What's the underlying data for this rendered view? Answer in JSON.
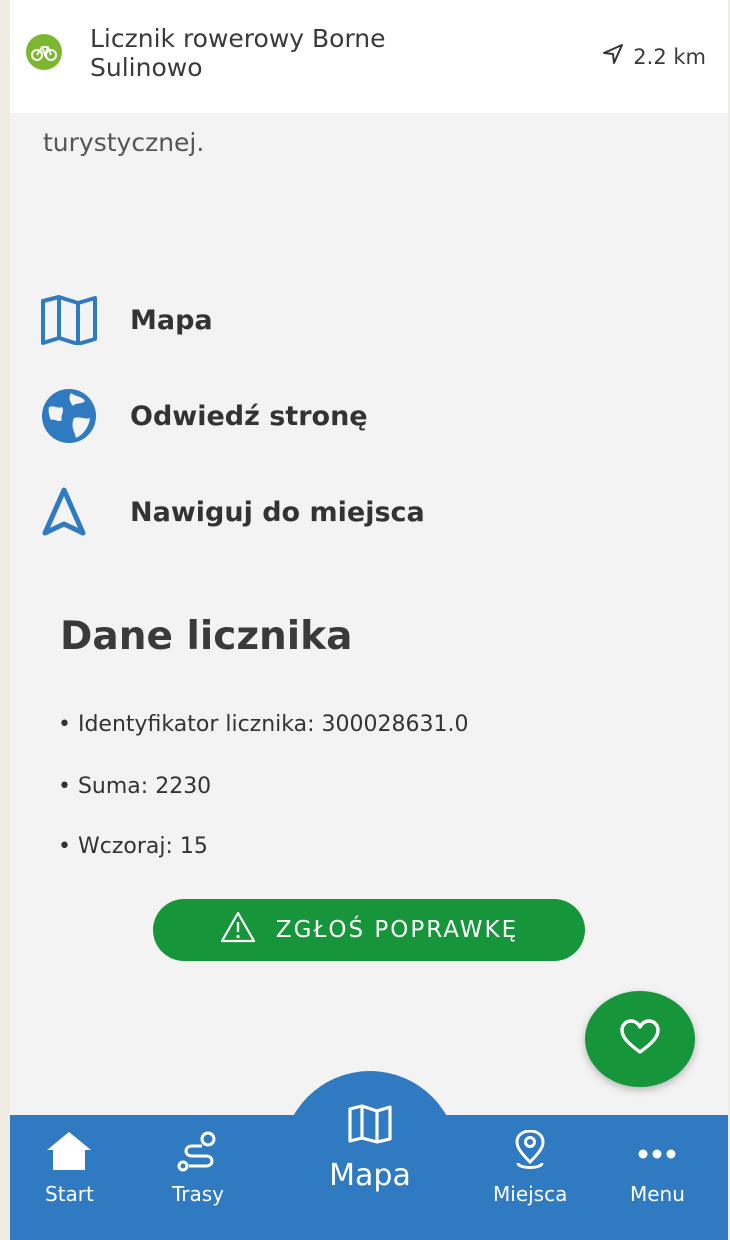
{
  "header": {
    "category_icon": "bicycle-icon",
    "title": "Licznik rowerowy Borne Sulinowo",
    "distance_icon": "navigation-arrow-icon",
    "distance": "2.2 km"
  },
  "description": {
    "visible_tail": "turystycznej."
  },
  "actions": [
    {
      "icon": "map-icon",
      "label": "Mapa"
    },
    {
      "icon": "globe-icon",
      "label": "Odwiedź stronę"
    },
    {
      "icon": "navigate-icon",
      "label": "Nawiguj do miejsca"
    }
  ],
  "counter": {
    "title": "Dane licznika",
    "lines": [
      "• Identyfikator licznika: 300028631.0",
      "• Suma: 2230",
      "• Wczoraj: 15"
    ]
  },
  "report_button": {
    "icon": "warning-icon",
    "label": "ZGŁOŚ POPRAWKĘ"
  },
  "favorite_button": {
    "icon": "heart-icon"
  },
  "bottom_nav": {
    "items": [
      {
        "icon": "home-icon",
        "label": "Start"
      },
      {
        "icon": "route-icon",
        "label": "Trasy"
      },
      {
        "icon": "map-icon",
        "label": "Mapa"
      },
      {
        "icon": "location-pin-icon",
        "label": "Miejsca"
      },
      {
        "icon": "more-icon",
        "label": "Menu"
      }
    ]
  },
  "colors": {
    "primary_green": "#16953a",
    "category_green": "#7cb82f",
    "nav_blue": "#2f7ac1",
    "icon_blue": "#2f7ac1"
  }
}
